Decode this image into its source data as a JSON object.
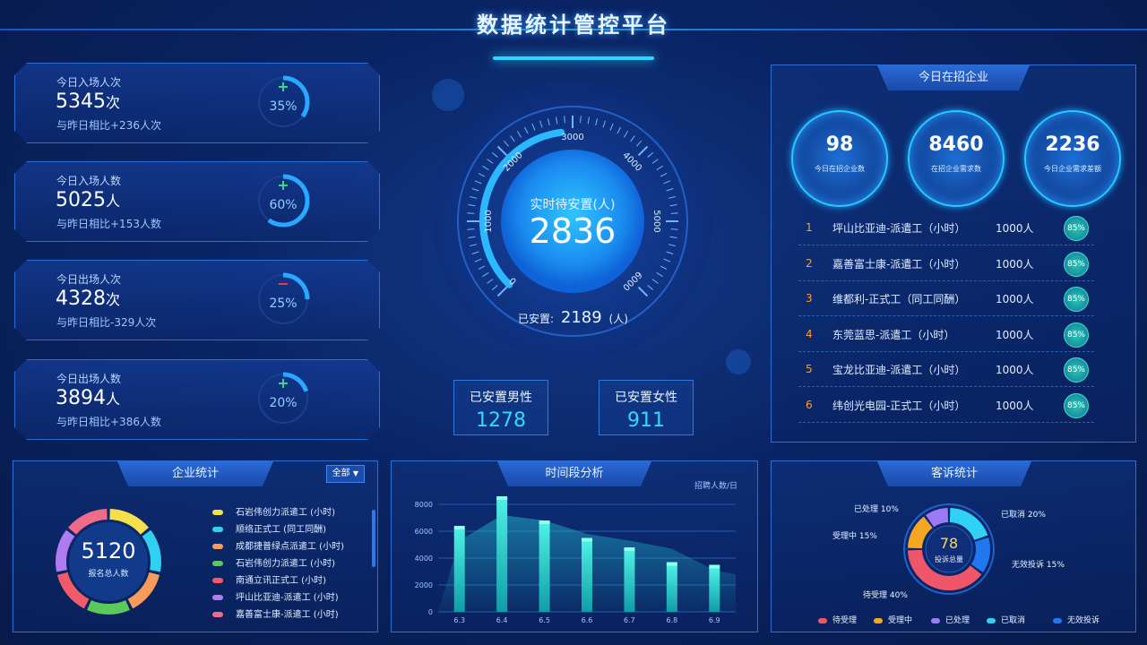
{
  "header": {
    "title": "数据统计管控平台"
  },
  "stat_cards": [
    {
      "label": "今日入场人次",
      "value": "5345",
      "unit": "次",
      "compare": "与昨日相比+236人次",
      "sign": "+",
      "percent_text": "35%",
      "percent": 35
    },
    {
      "label": "今日入场人数",
      "value": "5025",
      "unit": "人",
      "compare": "与昨日相比+153人数",
      "sign": "+",
      "percent_text": "60%",
      "percent": 60
    },
    {
      "label": "今日出场人次",
      "value": "4328",
      "unit": "次",
      "compare": "与昨日相比-329人次",
      "sign": "−",
      "percent_text": "25%",
      "percent": 25
    },
    {
      "label": "今日出场人数",
      "value": "3894",
      "unit": "人",
      "compare": "与昨日相比+386人数",
      "sign": "+",
      "percent_text": "20%",
      "percent": 20
    }
  ],
  "gauge": {
    "label": "实时待安置(人)",
    "value": "2836",
    "scale": [
      "0",
      "1000",
      "2000",
      "3000",
      "4000",
      "5000",
      "6000"
    ],
    "placed_label": "已安置:",
    "placed_value": "2189",
    "placed_unit": "(人)",
    "male_label": "已安置男性",
    "male_value": "1278",
    "female_label": "已安置女性",
    "female_value": "911"
  },
  "enterprises": {
    "title": "今日在招企业",
    "kpis": [
      {
        "value": "98",
        "label": "今日在招企业数"
      },
      {
        "value": "8460",
        "label": "在招企业需求数"
      },
      {
        "value": "2236",
        "label": "今日企业需求差额"
      }
    ],
    "rows": [
      {
        "rank": "1",
        "name": "坪山比亚迪-派遣工（小时）",
        "count": "1000人",
        "pct": "85%"
      },
      {
        "rank": "2",
        "name": "嘉善富士康-派遣工（小时）",
        "count": "1000人",
        "pct": "85%"
      },
      {
        "rank": "3",
        "name": "维都利-正式工（同工同酬）",
        "count": "1000人",
        "pct": "85%"
      },
      {
        "rank": "4",
        "name": "东莞蓝思-派遣工（小时）",
        "count": "1000人",
        "pct": "85%"
      },
      {
        "rank": "5",
        "name": "宝龙比亚迪-派遣工（小时）",
        "count": "1000人",
        "pct": "85%"
      },
      {
        "rank": "6",
        "name": "纬创光电园-正式工（小时）",
        "count": "1000人",
        "pct": "85%"
      }
    ]
  },
  "company_stats": {
    "title": "企业统计",
    "filter": "全部",
    "total": "5120",
    "total_label": "报名总人数",
    "legend": [
      {
        "name": "石岩伟创力派遣工 (小时)",
        "color": "#f5e04a"
      },
      {
        "name": "顺络正式工 (同工同酬)",
        "color": "#2fd0f0"
      },
      {
        "name": "成都捷普绿点派遣工 (小时)",
        "color": "#f79a5a"
      },
      {
        "name": "石岩伟创力派遣工 (小时)",
        "color": "#5ac85a"
      },
      {
        "name": "南通立讯正式工 (小时)",
        "color": "#f05a6a"
      },
      {
        "name": "坪山比亚迪-派遣工 (小时)",
        "color": "#b07af0"
      },
      {
        "name": "嘉善富士康-派遣工 (小时)",
        "color": "#f06a8a"
      }
    ]
  },
  "time_analysis": {
    "title": "时间段分析",
    "unit_label": "招聘人数/日"
  },
  "chart_data": {
    "type": "bar",
    "categories": [
      "6.3",
      "6.4",
      "6.5",
      "6.6",
      "6.7",
      "6.8",
      "6.9"
    ],
    "values": [
      6200,
      8400,
      6600,
      5300,
      4600,
      3500,
      3300
    ],
    "area": [
      5300,
      7200,
      6800,
      5800,
      5300,
      4700,
      3100
    ],
    "ylim": [
      0,
      8000
    ],
    "yticks": [
      "0",
      "2000",
      "4000",
      "6000",
      "8000"
    ],
    "ylabel": "招聘人数/日",
    "grid": true
  },
  "complaints": {
    "title": "客诉统计",
    "total": "78",
    "total_label": "投诉总量",
    "slices": [
      {
        "label": "待受理 40%",
        "value": 40,
        "color": "#f0566a"
      },
      {
        "label": "受理中 15%",
        "value": 15,
        "color": "#f5a623"
      },
      {
        "label": "已处理 10%",
        "value": 10,
        "color": "#9c7af5"
      },
      {
        "label": "已取消 20%",
        "value": 20,
        "color": "#2fd2f5"
      },
      {
        "label": "无效投诉 15%",
        "value": 15,
        "color": "#1f78f0"
      }
    ],
    "legend": [
      {
        "name": "待受理",
        "color": "#f0566a"
      },
      {
        "name": "受理中",
        "color": "#f5a623"
      },
      {
        "name": "已处理",
        "color": "#9c7af5"
      },
      {
        "name": "已取消",
        "color": "#2fd2f5"
      },
      {
        "name": "无效投诉",
        "color": "#1f78f0"
      }
    ]
  }
}
